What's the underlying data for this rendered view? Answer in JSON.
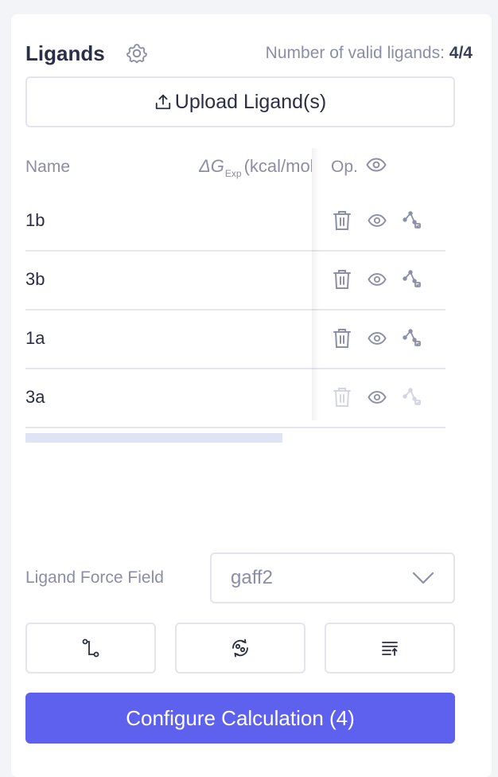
{
  "panel": {
    "title": "Ligands",
    "valid_label": "Number of valid ligands:",
    "valid_count": "4/4"
  },
  "upload": {
    "label": "Upload Ligand(s)"
  },
  "table": {
    "columns": {
      "name": "Name",
      "dg_symbol": "ΔG",
      "dg_sub": "Exp",
      "dg_unit": "(kcal/mol)",
      "op": "Op."
    },
    "rows": [
      {
        "name": "1b",
        "disabled": false
      },
      {
        "name": "3b",
        "disabled": false
      },
      {
        "name": "1a",
        "disabled": false
      },
      {
        "name": "3a",
        "disabled": true
      }
    ]
  },
  "force_field": {
    "label": "Ligand Force Field",
    "value": "gaff2"
  },
  "toolbar": [
    "path-icon",
    "refresh-icon",
    "sort-icon"
  ],
  "cta": {
    "label": "Configure Calculation (4)"
  },
  "colors": {
    "accent": "#5e61ee",
    "icon": "#8b8fa8",
    "icon_disabled": "#d3d5e2",
    "scrollbar": "#e0e2f5"
  }
}
